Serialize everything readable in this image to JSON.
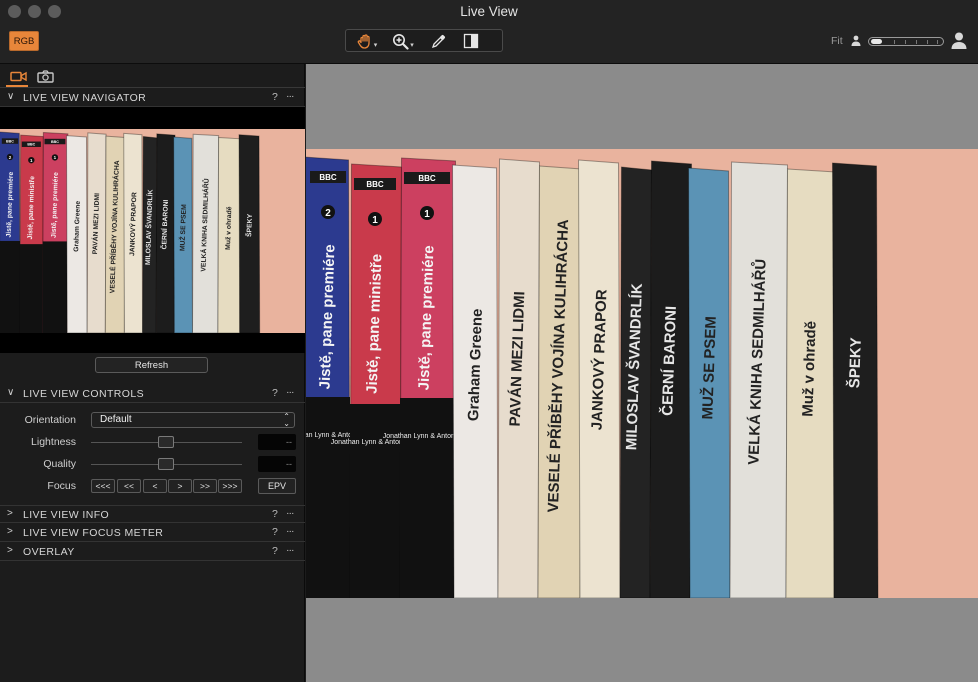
{
  "window": {
    "title": "Live View"
  },
  "toolbar": {
    "rgb_label": "RGB",
    "tools": [
      {
        "icon": "hand-tool-icon",
        "has_menu": true
      },
      {
        "icon": "zoom-tool-icon",
        "has_menu": true
      },
      {
        "icon": "eyedropper-icon",
        "has_menu": false
      },
      {
        "icon": "compare-split-icon",
        "has_menu": false
      }
    ],
    "fit_label": "Fit",
    "zoom_level": 0.05
  },
  "left_panel": {
    "tabs": [
      {
        "icon": "video-camera-icon",
        "active": true
      },
      {
        "icon": "still-camera-icon",
        "active": false
      }
    ],
    "navigator": {
      "title": "LIVE VIEW NAVIGATOR",
      "help": "?",
      "more": "···",
      "refresh_label": "Refresh"
    },
    "controls": {
      "title": "LIVE VIEW CONTROLS",
      "help": "?",
      "more": "···",
      "orientation_label": "Orientation",
      "orientation_value": "Default",
      "lightness_label": "Lightness",
      "lightness_value": "--",
      "quality_label": "Quality",
      "quality_value": "--",
      "focus_label": "Focus",
      "focus_buttons": [
        "<<<",
        "<<",
        "<",
        ">",
        ">>",
        ">>>"
      ],
      "epv_label": "EPV"
    },
    "collapsed_sections": [
      {
        "title": "LIVE VIEW INFO",
        "help": "?",
        "more": "···"
      },
      {
        "title": "LIVE VIEW FOCUS METER",
        "help": "?",
        "more": "···"
      },
      {
        "title": "OVERLAY",
        "help": "?",
        "more": "···"
      }
    ]
  },
  "image": {
    "books": [
      {
        "title": "Jistě, pane premiére",
        "volume": "2",
        "authors": "Jonathan Lynn & Antony Jay",
        "publisher": "BBC",
        "color": "#2c3a8f"
      },
      {
        "title": "Jistě, pane ministře",
        "volume": "1",
        "authors": "Jonathan Lynn & Antony Jay",
        "publisher": "BBC",
        "color": "#c93a4b"
      },
      {
        "title": "Jistě, pane premiére",
        "volume": "1",
        "authors": "Jonathan Lynn & Antony Jay",
        "publisher": "BBC",
        "color": "#cc4060"
      },
      {
        "title": "Graham Greene",
        "color": "#ece8e4"
      },
      {
        "title": "PAVÁN MEZI LIDMI",
        "color": "#e7dccd"
      },
      {
        "title": "VESELÉ PŘÍBĚHY VOJÍNA KULIHRÁCHA",
        "color": "#e1d3b4"
      },
      {
        "title": "JANKOVÝ PRAPOR",
        "color": "#ece3d0"
      },
      {
        "title": "MILOSLAV ŠVANDRLÍK",
        "color": "#232323"
      },
      {
        "title": "ČERNÍ BARONI",
        "color": "#1c1c1c"
      },
      {
        "title": "MUŽ SE PSEM",
        "color": "#5b93b5"
      },
      {
        "title": "VELKÁ KNIHA SEDMILHÁŘŮ",
        "color": "#e2e0da"
      },
      {
        "title": "Muž v ohradě",
        "color": "#e6dcc1"
      },
      {
        "title": "ŠPEKY",
        "color": "#1e1e1e"
      }
    ]
  }
}
